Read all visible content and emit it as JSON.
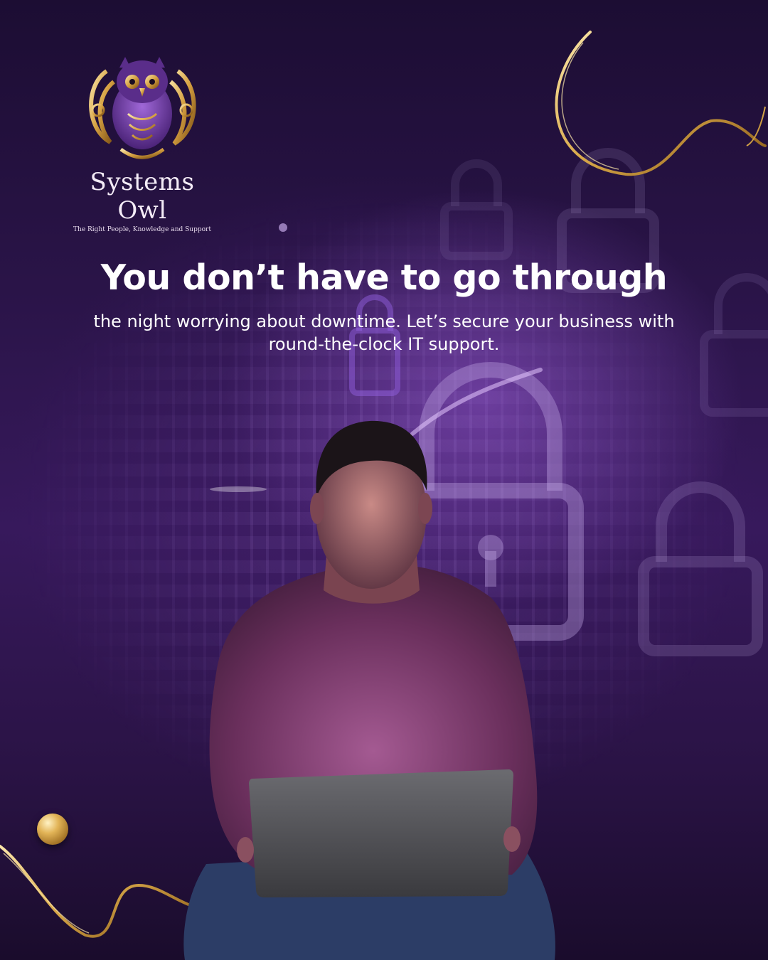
{
  "brand": {
    "name": "Systems Owl",
    "tagline": "The Right People, Knowledge and Support",
    "logo_icon": "owl-icon"
  },
  "headline": "You don’t have to go through",
  "subtext_line1": "the night worrying about downtime. Let’s secure your business with",
  "subtext_line2": "round-the-clock IT support.",
  "colors": {
    "background": "#2a1448",
    "gold": "#d9a94a",
    "text": "#ffffff"
  }
}
